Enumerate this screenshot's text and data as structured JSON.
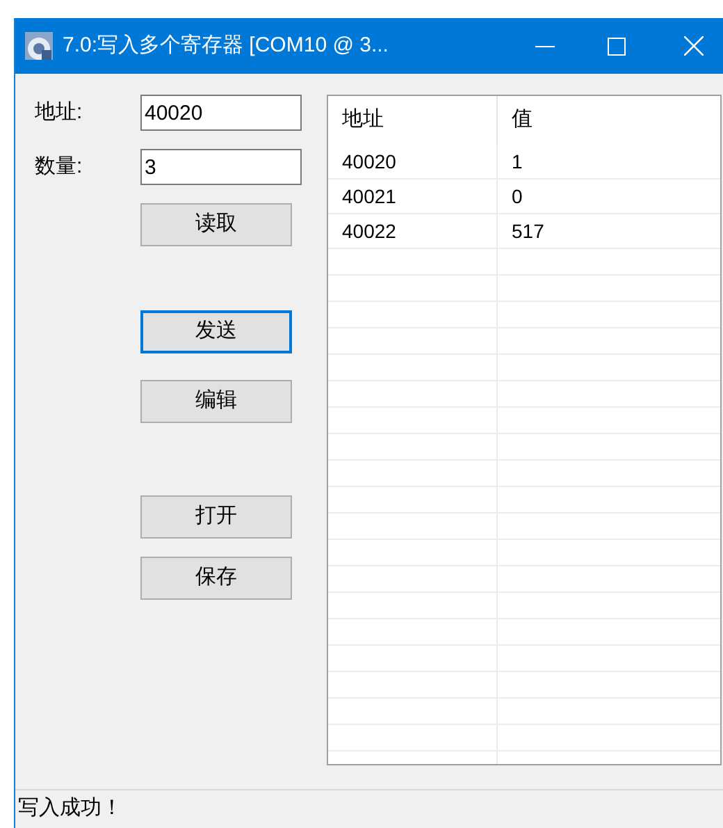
{
  "window": {
    "title": "7.0:写入多个寄存器 [COM10 @ 3..."
  },
  "fields": [
    {
      "label": "地址:",
      "value": "40020"
    },
    {
      "label": "数量:",
      "value": "3"
    }
  ],
  "buttons": [
    {
      "label": "读取",
      "focused": false
    },
    {
      "label": "发送",
      "focused": true
    },
    {
      "label": "编辑",
      "focused": false
    },
    {
      "label": "打开",
      "focused": false
    },
    {
      "label": "保存",
      "focused": false
    }
  ],
  "table": {
    "columns": [
      "地址",
      "值"
    ],
    "rows": [
      [
        "40020",
        "1"
      ],
      [
        "40021",
        "0"
      ],
      [
        "40022",
        "517"
      ]
    ]
  },
  "status_bar": "写入成功！"
}
